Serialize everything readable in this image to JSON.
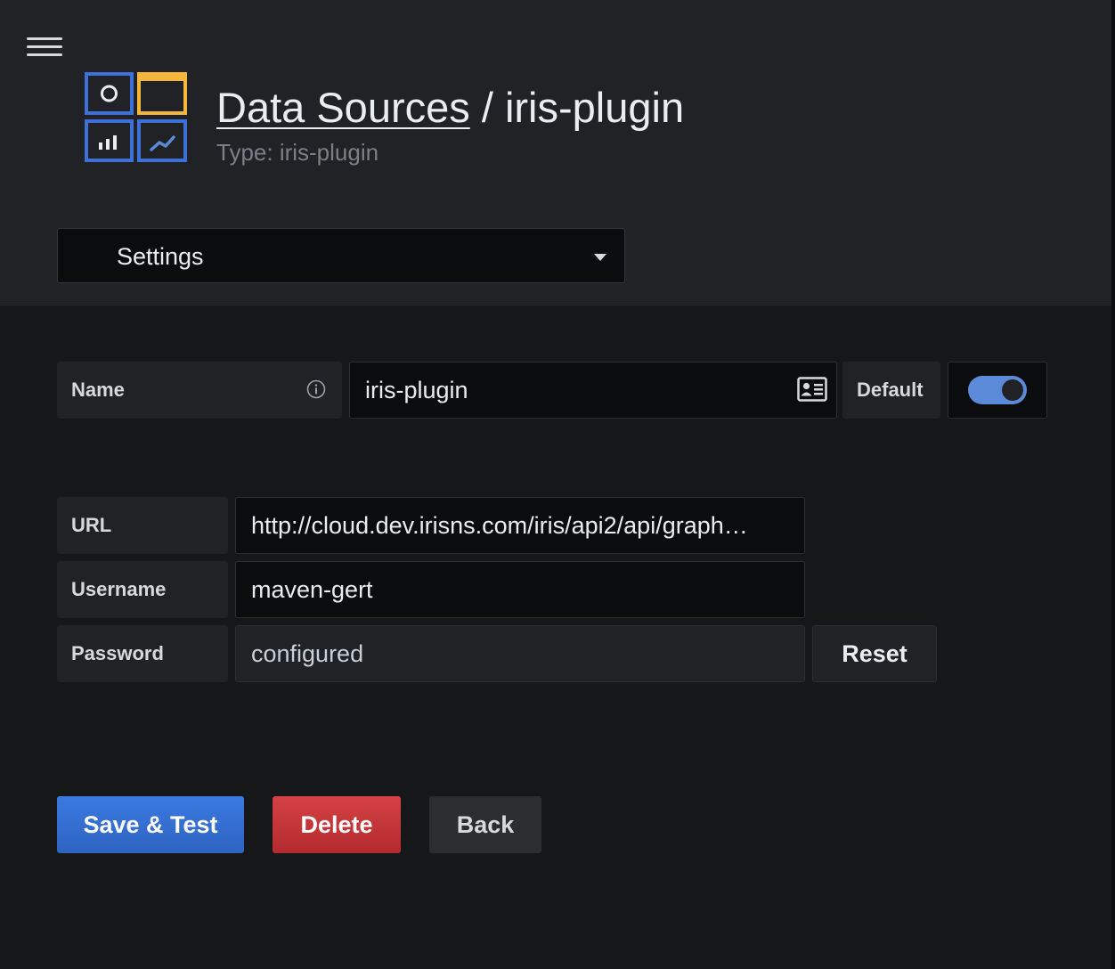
{
  "header": {
    "breadcrumb_link": "Data Sources",
    "separator": " / ",
    "title": "iris-plugin",
    "subtitle": "Type: iris-plugin"
  },
  "tabs": {
    "selected": "Settings"
  },
  "name_field": {
    "label": "Name",
    "value": "iris-plugin",
    "default_label": "Default",
    "default_enabled": true
  },
  "http": {
    "url_label": "URL",
    "url_value": "http://cloud.dev.irisns.com/iris/api2/api/graph…",
    "username_label": "Username",
    "username_value": "maven-gert",
    "password_label": "Password",
    "password_value": "configured",
    "reset_label": "Reset"
  },
  "actions": {
    "save_label": "Save & Test",
    "delete_label": "Delete",
    "back_label": "Back"
  },
  "colors": {
    "primary": "#3274d9",
    "danger": "#c4292d",
    "toggle_on": "#5a8ad8",
    "logo_blue": "#3d71d9",
    "logo_yellow": "#f5b73b"
  }
}
